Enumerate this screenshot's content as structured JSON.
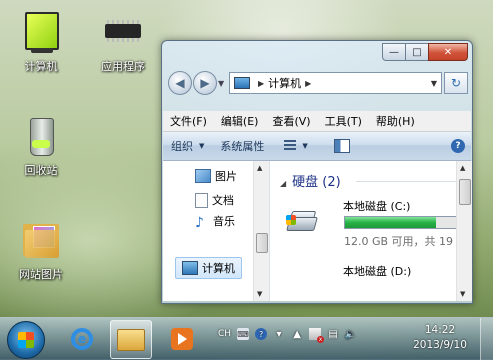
{
  "desktop": {
    "icons": [
      {
        "label": "计算机"
      },
      {
        "label": "应用程序"
      },
      {
        "label": "回收站"
      },
      {
        "label": "网站图片"
      }
    ]
  },
  "explorer": {
    "address": {
      "location": "计算机"
    },
    "menu": [
      "文件(F)",
      "编辑(E)",
      "查看(V)",
      "工具(T)",
      "帮助(H)"
    ],
    "commands": {
      "organize": "组织",
      "system_properties": "系统属性"
    },
    "nav": {
      "items": [
        {
          "label": "图片",
          "icon": "pictures-icon"
        },
        {
          "label": "文档",
          "icon": "documents-icon"
        },
        {
          "label": "音乐",
          "icon": "music-icon"
        }
      ],
      "selected": {
        "label": "计算机",
        "icon": "computer-icon"
      }
    },
    "content": {
      "group_header": "硬盘 (2)",
      "drive_c": {
        "name": "本地磁盘 (C:)",
        "free_info": "12.0 GB 可用，共 19",
        "used_fraction": 0.8
      },
      "drive_d": {
        "name": "本地磁盘 (D:)"
      }
    }
  },
  "taskbar": {
    "tray": {
      "ime": "CH"
    },
    "clock": {
      "time": "14:22",
      "date": "2013/9/10"
    }
  },
  "colors": {
    "drive_bar": "#27b247",
    "accent": "#1e3287"
  }
}
